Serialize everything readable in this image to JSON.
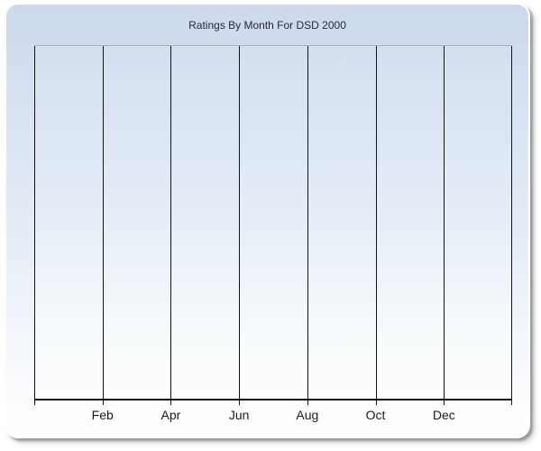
{
  "chart": {
    "title": "Ratings By Month For DSD 2000",
    "x_tick_labels": [
      "Feb",
      "Apr",
      "Jun",
      "Aug",
      "Oct",
      "Dec"
    ],
    "gridline_count": 8
  },
  "colors": {
    "panel_gradient_top": "#ccd9ed",
    "panel_gradient_bottom": "#ffffff",
    "plot_gradient_top": "#d3dff0",
    "plot_gradient_bottom": "#fdfdfe",
    "gridline": "#141414",
    "axis_line": "#111111",
    "plot_top_border": "#a8aeb9",
    "title_text": "#26263f",
    "axis_label_text": "#1a1a1a",
    "window_background": "#ffffff",
    "shadow": "#787878"
  },
  "chart_data": {
    "type": "line",
    "title": "Ratings By Month For DSD 2000",
    "categories": [
      "Feb",
      "Apr",
      "Jun",
      "Aug",
      "Oct",
      "Dec"
    ],
    "series": [],
    "x_tick_interval_months": 2,
    "grid": "vertical-only",
    "legend": "none",
    "y_axis_ticks": "none"
  }
}
